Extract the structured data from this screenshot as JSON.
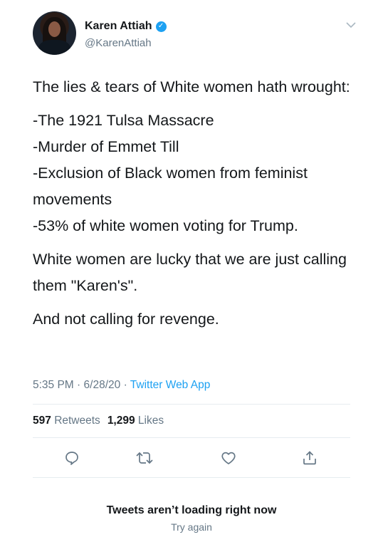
{
  "author": {
    "name": "Karen Attiah",
    "handle": "@KarenAttiah",
    "verified_glyph": "✓",
    "avatar_icon": "profile-photo"
  },
  "tweet": {
    "lines": [
      "The lies & tears of White women hath wrought:",
      "-The 1921 Tulsa Massacre",
      "-Murder of Emmet Till",
      "-Exclusion of Black women from feminist movements",
      "-53% of white women voting for Trump.",
      "White women are lucky that we are just calling them \"Karen's\".",
      "And not calling for revenge."
    ]
  },
  "meta": {
    "time": "5:35 PM",
    "date": "6/28/20",
    "separator": "·",
    "app": "Twitter Web App"
  },
  "stats": {
    "retweets_count": "597",
    "retweets_label": "Retweets",
    "likes_count": "1,299",
    "likes_label": "Likes"
  },
  "actions": {
    "reply_icon": "reply-icon",
    "retweet_icon": "retweet-icon",
    "like_icon": "heart-icon",
    "share_icon": "share-icon"
  },
  "loading": {
    "title": "Tweets aren’t loading right now",
    "retry": "Try again"
  },
  "colors": {
    "text": "#14171a",
    "secondary": "#657786",
    "accent": "#1da1f2",
    "divider": "#e6ecf0"
  }
}
